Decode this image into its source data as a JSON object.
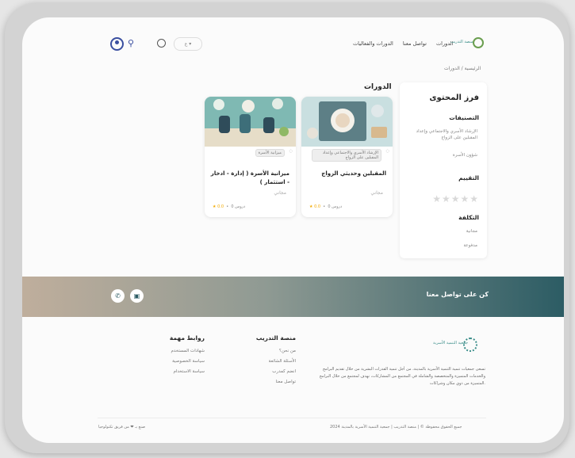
{
  "header": {
    "lang_label": "ع ▾",
    "nav": [
      "الدورات",
      "تواصل معنا",
      "الدورات والفعاليات"
    ],
    "logo_text": "منصة التدريب"
  },
  "breadcrumb": "الرئيسية / الدورات",
  "filter": {
    "title": "فرز المحتوى",
    "categories_title": "التصنيفات",
    "categories": [
      "الإرشاد الأسري والاجتماعي وإعداد المقبلين على الزواج",
      "شؤون الأسرة"
    ],
    "rating_title": "التقييم",
    "stars": "★★★★★",
    "cost_title": "التكلفة",
    "costs": [
      "مجانية",
      "مدفوعة"
    ]
  },
  "courses": {
    "heading": "الدورات",
    "items": [
      {
        "tag": "الإرشاد الأسري والاجتماعي وإعداد المقبلين على الزواج",
        "title": "المقبلين وحديثي الزواج",
        "price": "مجاني",
        "rating": "★ 0.0",
        "lessons": "0 دروس"
      },
      {
        "tag": "ميزانية الأسرة",
        "title": "ميزانية الأسرة ( إدارة - ادخار - استثمار )",
        "price": "مجاني",
        "rating": "★ 0.0",
        "lessons": "0 دروس"
      }
    ]
  },
  "contact": {
    "label": "كن على تواصل معنا"
  },
  "footer": {
    "logo_text": "جمعية التنمية الأسرية",
    "description": "تسعى جمعيات تنمية التنمية الأسرية بالمدينة، من أجل تنمية القدرات البشرية من خلال تقديم البرامج والخدمات المتميزة والمتخصصة والشاملة في المجتمع من المشاركات، نهدف لمجتمع من خلال البرامج المتميزة من ذوي مكان وشراكات.",
    "platform_title": "منصة التدريب",
    "platform_links": [
      "من نحن؟",
      "الأسئلة الشائعة",
      "انضم كمدرب",
      "تواصل معنا"
    ],
    "links_title": "روابط مهمة",
    "links": [
      "شهادات المستخدم",
      "سياسة الخصوصية",
      "سياسة الاستخدام"
    ],
    "copyright": "جميع الحقوق محفوظة © | منصة التدريب | جمعية التنمية الأسرية بالمدينة 2024",
    "powered": "صنع بـ ❤ من فريق تكنولوجيا"
  },
  "colors": {
    "accent": "#2c5c64",
    "star": "#f2a900"
  }
}
